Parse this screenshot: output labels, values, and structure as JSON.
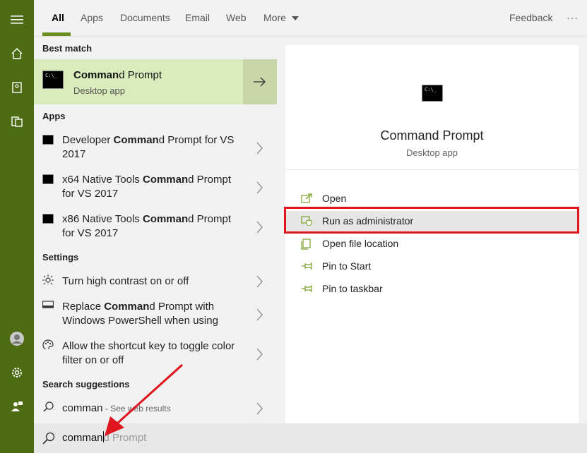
{
  "tabs": [
    "All",
    "Apps",
    "Documents",
    "Email",
    "Web",
    "More"
  ],
  "feedback": "Feedback",
  "more_options": "···",
  "best_match": {
    "header": "Best match",
    "title_bold": "Comman",
    "title_rest": "d Prompt",
    "subtitle": "Desktop app"
  },
  "apps": {
    "header": "Apps",
    "items": [
      {
        "pre": "Developer ",
        "bold": "Comman",
        "post": "d Prompt for VS 2017"
      },
      {
        "pre": "x64 Native Tools ",
        "bold": "Comman",
        "post": "d Prompt for VS 2017"
      },
      {
        "pre": "x86 Native Tools ",
        "bold": "Comman",
        "post": "d Prompt for VS 2017"
      }
    ]
  },
  "settings": {
    "header": "Settings",
    "items": [
      {
        "pre": "Turn high contrast on or off",
        "bold": "",
        "post": ""
      },
      {
        "pre": "Replace ",
        "bold": "Comman",
        "post": "d Prompt with Windows PowerShell when using"
      },
      {
        "pre": "Allow the shortcut key to toggle color filter on or off",
        "bold": "",
        "post": ""
      }
    ]
  },
  "suggestions": {
    "header": "Search suggestions",
    "query": "comman",
    "hint": " - See web results"
  },
  "detail": {
    "title": "Command Prompt",
    "subtitle": "Desktop app"
  },
  "actions": [
    "Open",
    "Run as administrator",
    "Open file location",
    "Pin to Start",
    "Pin to taskbar"
  ],
  "search": {
    "typed": "comman",
    "completion": "d Prompt"
  },
  "colors": {
    "accent": "#4c6b12",
    "highlight": "#dbecbc",
    "annotation": "#e0161e"
  }
}
